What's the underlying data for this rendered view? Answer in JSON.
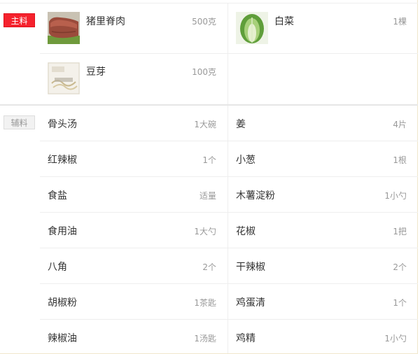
{
  "main_section": {
    "tag": "主料",
    "items": [
      {
        "name": "猪里脊肉",
        "amount": "500克",
        "icon": "pork-loin-photo"
      },
      {
        "name": "白菜",
        "amount": "1棵",
        "icon": "napa-cabbage-photo"
      },
      {
        "name": "豆芽",
        "amount": "100克",
        "icon": "bean-sprouts-photo"
      }
    ]
  },
  "aux_section": {
    "tag": "辅料",
    "items": [
      {
        "name": "骨头汤",
        "amount": "1大碗"
      },
      {
        "name": "姜",
        "amount": "4片"
      },
      {
        "name": "红辣椒",
        "amount": "1个"
      },
      {
        "name": "小葱",
        "amount": "1根"
      },
      {
        "name": "食盐",
        "amount": "适量"
      },
      {
        "name": "木薯淀粉",
        "amount": "1小勺"
      },
      {
        "name": "食用油",
        "amount": "1大勺"
      },
      {
        "name": "花椒",
        "amount": "1把"
      },
      {
        "name": "八角",
        "amount": "2个"
      },
      {
        "name": "干辣椒",
        "amount": "2个"
      },
      {
        "name": "胡椒粉",
        "amount": "1茶匙"
      },
      {
        "name": "鸡蛋清",
        "amount": "1个"
      },
      {
        "name": "辣椒油",
        "amount": "1汤匙"
      },
      {
        "name": "鸡精",
        "amount": "1小勺"
      }
    ]
  },
  "colors": {
    "main_tag_bg": "#f5222d",
    "aux_tag_bg": "#f2f2f2",
    "text": "#333333",
    "muted": "#999999",
    "border": "#eeeeee"
  }
}
